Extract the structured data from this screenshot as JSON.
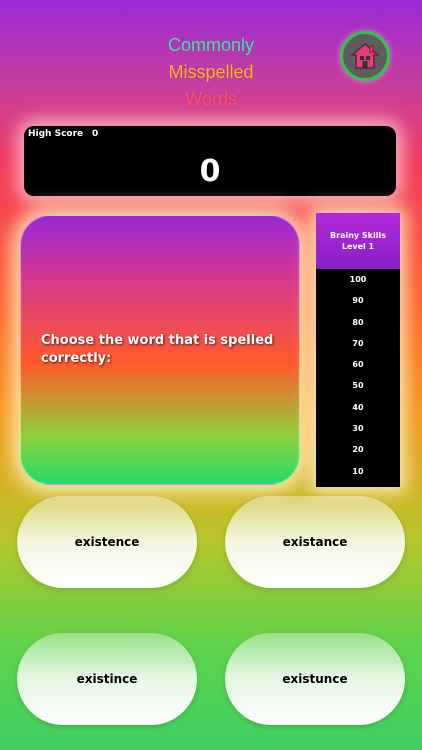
{
  "app": {
    "title_lines": [
      "Commonly",
      "Misspelled",
      "Words"
    ],
    "home_icon": "house-icon"
  },
  "score_panel": {
    "high_score_label": "High Score",
    "high_score_value": "0",
    "score": "0"
  },
  "question": {
    "text": "Choose the word that is spelled correctly:"
  },
  "level_panel": {
    "title": "Brainy Skills",
    "level": "Level 1",
    "points": [
      "100",
      "90",
      "80",
      "70",
      "60",
      "50",
      "40",
      "30",
      "20",
      "10"
    ]
  },
  "answers": [
    "existence",
    "existance",
    "existince",
    "existunce"
  ],
  "colors": {
    "title_line1": "#3ee6a8",
    "title_line2": "#ffb21f",
    "title_line3": "#ff4f6a",
    "home_ring": "#36c14a"
  }
}
